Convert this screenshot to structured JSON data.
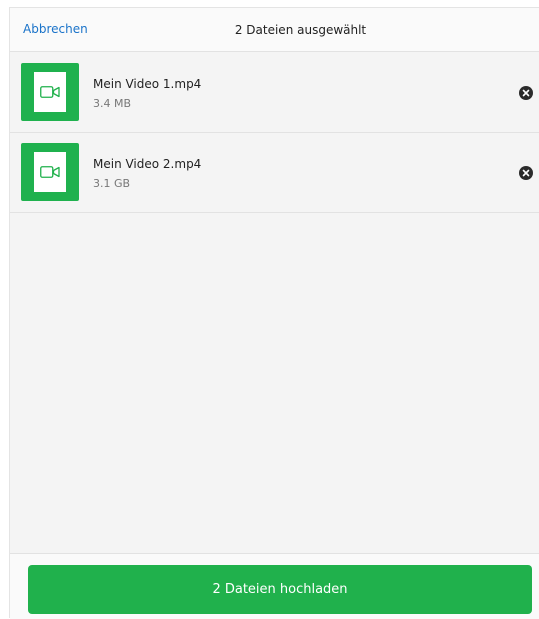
{
  "header": {
    "cancel_label": "Abbrechen",
    "title": "2 Dateien ausgewählt"
  },
  "files": [
    {
      "name": "Mein Video 1.mp4",
      "size": "3.4 MB",
      "icon": "video-camera-icon"
    },
    {
      "name": "Mein Video 2.mp4",
      "size": "3.1 GB",
      "icon": "video-camera-icon"
    }
  ],
  "footer": {
    "upload_label": "2 Dateien hochladen"
  },
  "colors": {
    "accent_green": "#20b14c",
    "link_blue": "#1a73c9",
    "remove_dark": "#2b2b2b"
  }
}
